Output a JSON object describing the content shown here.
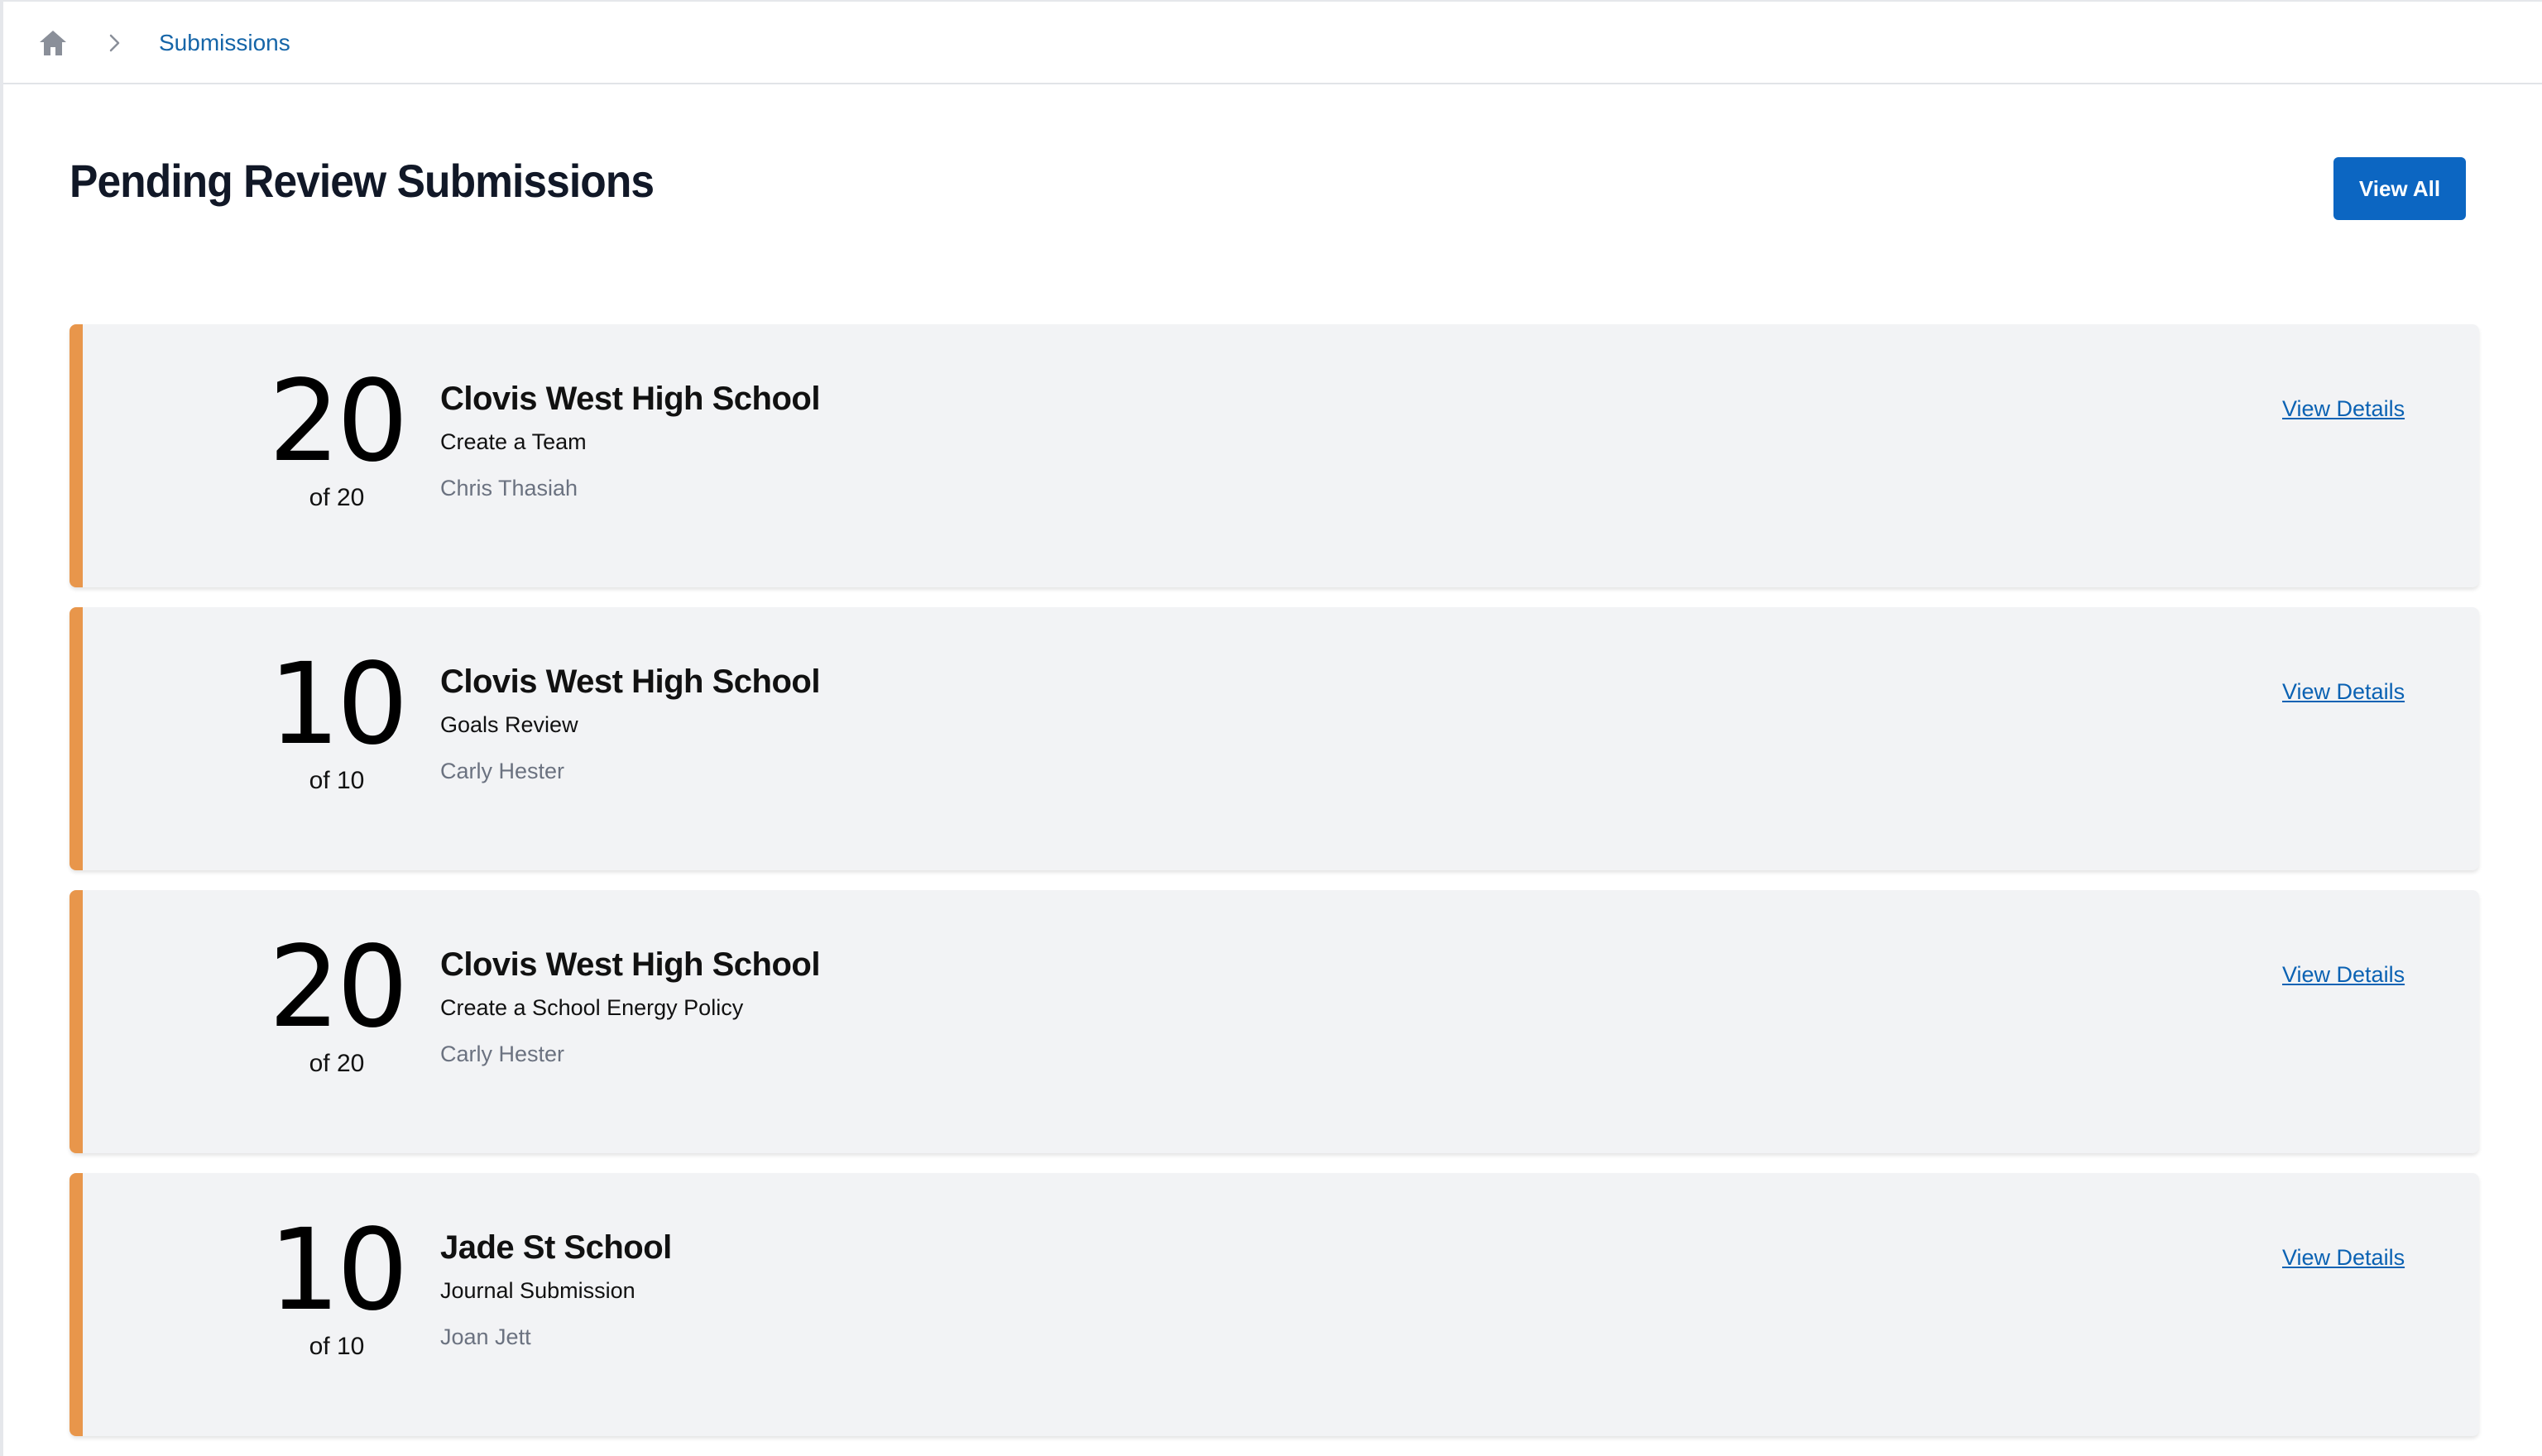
{
  "breadcrumb": {
    "home_icon": "home-icon",
    "separator_icon": "chevron-right-icon",
    "current": "Submissions"
  },
  "header": {
    "title": "Pending Review Submissions",
    "view_all_label": "View All"
  },
  "colors": {
    "accent": "#e8964b",
    "primary_button": "#0c66c2",
    "link": "#0b62b3",
    "card_background": "#f2f3f5"
  },
  "submissions": [
    {
      "score": "20",
      "total": "of 20",
      "school": "Clovis West High School",
      "activity": "Create a Team",
      "person": "Chris Thasiah",
      "link_label": "View Details"
    },
    {
      "score": "10",
      "total": "of 10",
      "school": "Clovis West High School",
      "activity": "Goals Review",
      "person": "Carly Hester",
      "link_label": "View Details"
    },
    {
      "score": "20",
      "total": "of 20",
      "school": "Clovis West High School",
      "activity": "Create a School Energy Policy",
      "person": "Carly Hester",
      "link_label": "View Details"
    },
    {
      "score": "10",
      "total": "of 10",
      "school": "Jade St School",
      "activity": "Journal Submission",
      "person": "Joan Jett",
      "link_label": "View Details"
    }
  ]
}
